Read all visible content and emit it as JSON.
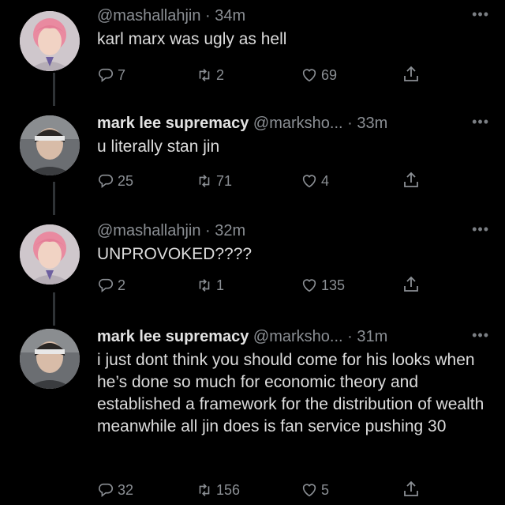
{
  "tweets": [
    {
      "display_name": "",
      "handle": "@mashallahjin",
      "time": "34m",
      "text": "karl marx was ugly as hell",
      "replies": "7",
      "retweets": "2",
      "likes": "69",
      "avatar": "pink-hair-avatar"
    },
    {
      "display_name": "mark lee supremacy",
      "handle": "@marksho...",
      "time": "33m",
      "text": "u literally stan jin",
      "replies": "25",
      "retweets": "71",
      "likes": "4",
      "avatar": "headband-avatar"
    },
    {
      "display_name": "",
      "handle": "@mashallahjin",
      "time": "32m",
      "text": "UNPROVOKED????",
      "replies": "2",
      "retweets": "1",
      "likes": "135",
      "avatar": "pink-hair-avatar"
    },
    {
      "display_name": "mark lee supremacy",
      "handle": "@marksho...",
      "time": "31m",
      "text": "i just dont think you should come for his looks when he’s done so much for economic theory and established a framework for the distribution of wealth meanwhile all jin does is fan service pushing 30",
      "replies": "32",
      "retweets": "156",
      "likes": "5",
      "avatar": "headband-avatar"
    }
  ],
  "ui": {
    "separator": "·",
    "more": "•••",
    "icons": [
      "reply-icon",
      "retweet-icon",
      "like-icon",
      "share-icon"
    ],
    "colors": {
      "background": "#000000",
      "text": "#dcdcdc",
      "muted": "#8b8f94",
      "thread_line": "#2f3336"
    }
  }
}
